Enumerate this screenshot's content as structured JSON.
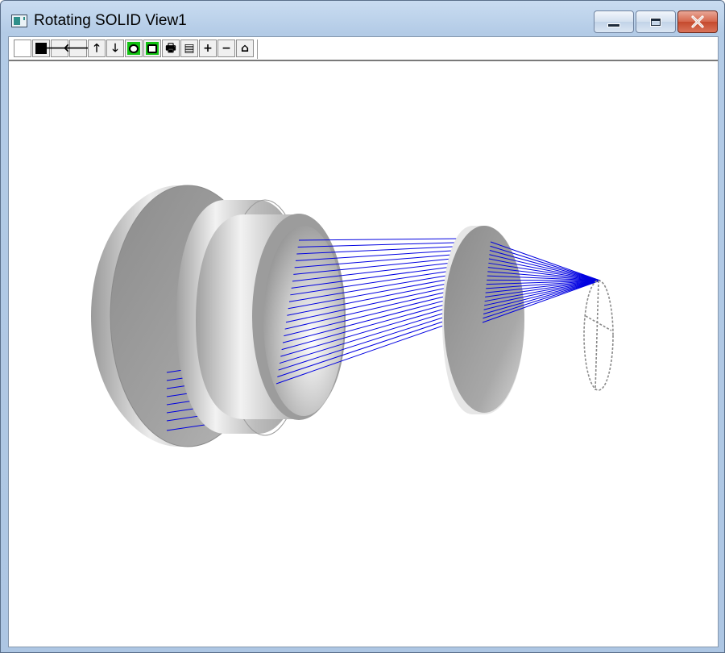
{
  "window": {
    "title": "Rotating SOLID View1"
  },
  "toolbar": {
    "buttons": [
      {
        "name": "white-background-button",
        "icon": "white-square-icon",
        "glyph": ""
      },
      {
        "name": "black-background-button",
        "icon": "black-square-icon",
        "glyph": ""
      },
      {
        "name": "rotate-right-button",
        "icon": "arrow-right-icon",
        "glyph": "🡒"
      },
      {
        "name": "rotate-left-button",
        "icon": "arrow-left-icon",
        "glyph": "🡐"
      },
      {
        "name": "rotate-up-button",
        "icon": "arrow-up-icon",
        "glyph": "🡑"
      },
      {
        "name": "rotate-down-button",
        "icon": "arrow-down-icon",
        "glyph": "🡓"
      },
      {
        "name": "camera-view-a-button",
        "icon": "camera-icon",
        "glyph": ""
      },
      {
        "name": "camera-view-b-button",
        "icon": "camera-icon",
        "glyph": ""
      },
      {
        "name": "print-button",
        "icon": "printer-icon",
        "glyph": "🖶"
      },
      {
        "name": "copy-button",
        "icon": "clipboard-icon",
        "glyph": "▤"
      },
      {
        "name": "zoom-in-button",
        "icon": "plus-icon",
        "glyph": "+"
      },
      {
        "name": "zoom-out-button",
        "icon": "minus-icon",
        "glyph": "−"
      },
      {
        "name": "home-view-button",
        "icon": "house-icon",
        "glyph": "⌂"
      }
    ]
  },
  "colors": {
    "ray": "#0000e0",
    "solid_light": "#e4e4e4",
    "solid_mid": "#b4b4b4",
    "solid_dark": "#8c8c8c",
    "image_plane": "#8a8a8a"
  }
}
